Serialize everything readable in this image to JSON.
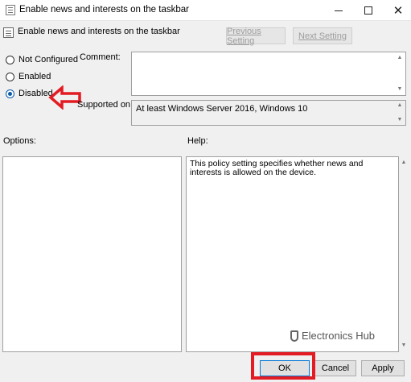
{
  "window": {
    "title": "Enable news and interests on the taskbar",
    "controls": {
      "minimize": "minimize",
      "maximize": "maximize",
      "close": "✕"
    }
  },
  "header": {
    "title": "Enable news and interests on the taskbar",
    "prev_label": "Previous Setting",
    "next_label": "Next Setting"
  },
  "state": {
    "options": [
      {
        "label": "Not Configured",
        "checked": false
      },
      {
        "label": "Enabled",
        "checked": false
      },
      {
        "label": "Disabled",
        "checked": true
      }
    ]
  },
  "comment": {
    "label": "Comment:",
    "value": ""
  },
  "supported": {
    "label": "Supported on:",
    "value": "At least Windows Server 2016, Windows 10"
  },
  "options_panel": {
    "label": "Options:"
  },
  "help_panel": {
    "label": "Help:",
    "text": "This policy setting specifies whether news and interests is allowed on the device."
  },
  "watermark": {
    "text": "Electronics Hub"
  },
  "footer": {
    "ok_label": "OK",
    "cancel_label": "Cancel",
    "apply_label": "Apply"
  },
  "annotations": {
    "highlight_color": "#e31b23"
  }
}
